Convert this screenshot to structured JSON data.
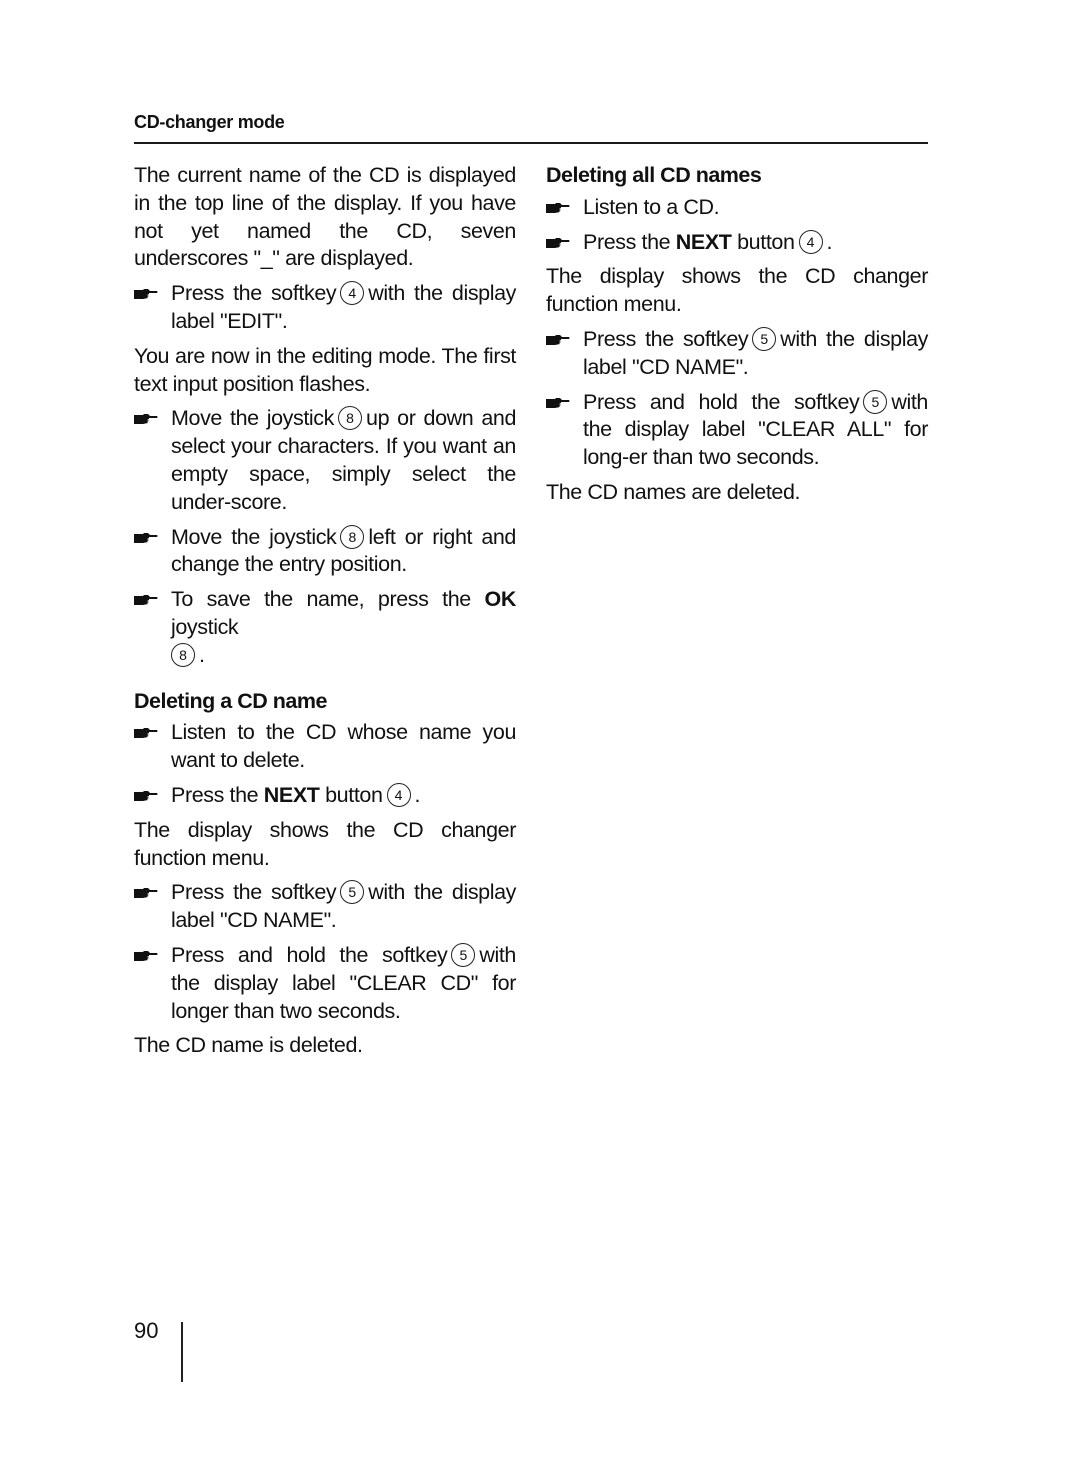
{
  "header": {
    "title": "CD-changer mode"
  },
  "left": {
    "intro": "The current name of the CD is displayed in the top line of the display. If you have not yet named the CD, seven underscores \"_\" are displayed.",
    "step1": {
      "a": "Press the softkey",
      "num": "4",
      "b": "with the display label \"EDIT\"."
    },
    "edit_note": "You are now in the editing mode. The first text input position flashes.",
    "step2": {
      "a": "Move the joystick",
      "num": "8",
      "b": "up or down and select your characters. If you want an empty space, simply select the under-score."
    },
    "step3": {
      "a": "Move the joystick",
      "num": "8",
      "b": "left or right and change the entry position."
    },
    "step4": {
      "a": "To save the name, press the",
      "bold": "OK",
      "b": "joystick",
      "num": "8",
      "c": "."
    },
    "section": {
      "title": "Deleting a CD name",
      "step1": "Listen to the CD whose name you want to delete.",
      "step2": {
        "a": "Press the",
        "bold": "NEXT",
        "b": "button",
        "num": "4",
        "c": "."
      },
      "note": "The display shows the CD changer function menu.",
      "step3": {
        "a": "Press the softkey",
        "num": "5",
        "b": "with the display label \"CD NAME\"."
      },
      "step4": {
        "a": "Press and hold the softkey",
        "num": "5",
        "b": "with the display label \"CLEAR CD\" for longer than two seconds."
      },
      "result": "The CD name is deleted."
    }
  },
  "right": {
    "section": {
      "title": "Deleting all CD names",
      "step1": "Listen to a CD.",
      "step2": {
        "a": "Press the",
        "bold": "NEXT",
        "b": "button",
        "num": "4",
        "c": "."
      },
      "note": "The display shows the CD changer function menu.",
      "step3": {
        "a": "Press the softkey",
        "num": "5",
        "b": "with the display label \"CD NAME\"."
      },
      "step4": {
        "a": "Press and hold the softkey",
        "num": "5",
        "b": "with the display label \"CLEAR ALL\" for long-er than two seconds."
      },
      "result": "The CD names are deleted."
    }
  },
  "footer": {
    "page_number": "90"
  }
}
